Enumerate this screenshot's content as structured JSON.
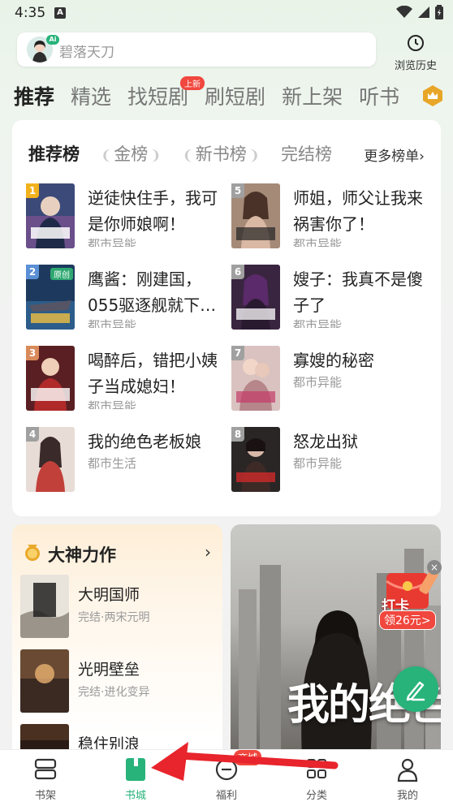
{
  "status_bar": {
    "time": "4:35",
    "notification_letter": "A"
  },
  "search": {
    "placeholder": "碧落天刀",
    "ai_badge": "Ai",
    "history_label": "浏览历史"
  },
  "tabs": [
    {
      "label": "推荐",
      "active": true
    },
    {
      "label": "精选"
    },
    {
      "label": "找短剧",
      "badge": "上新"
    },
    {
      "label": "刷短剧"
    },
    {
      "label": "新上架"
    },
    {
      "label": "听书"
    }
  ],
  "ranking": {
    "tabs": [
      {
        "label": "推荐榜",
        "active": true
      },
      {
        "label": "金榜"
      },
      {
        "label": "新书榜"
      },
      {
        "label": "完结榜"
      }
    ],
    "more_label": "更多榜单›",
    "books": [
      {
        "rank": "1",
        "title": "逆徒快住手，我可是你师娘啊！",
        "tag": "都市异能"
      },
      {
        "rank": "2",
        "title": "鹰酱：刚建国，055驱逐舰就下…",
        "tag": "都市异能",
        "badge": "原创"
      },
      {
        "rank": "3",
        "title": "喝醉后，错把小姨子当成媳妇！",
        "tag": "都市异能"
      },
      {
        "rank": "4",
        "title": "我的绝色老板娘",
        "tag": "都市生活"
      },
      {
        "rank": "5",
        "title": "师姐，师父让我来祸害你了！",
        "tag": "都市异能"
      },
      {
        "rank": "6",
        "title": "嫂子：我真不是傻子了",
        "tag": "都市异能"
      },
      {
        "rank": "7",
        "title": "寡嫂的秘密",
        "tag": "都市异能"
      },
      {
        "rank": "8",
        "title": "怒龙出狱",
        "tag": "都市异能"
      }
    ]
  },
  "god_works": {
    "title": "大神力作",
    "arrow": "›",
    "items": [
      {
        "name": "大明国师",
        "tag": "完结·两宋元明"
      },
      {
        "name": "光明壁垒",
        "tag": "完结·进化变异"
      },
      {
        "name": "稳住别浪",
        "tag": ""
      }
    ]
  },
  "banner": {
    "text": "我的绝色小姨"
  },
  "checkin": {
    "label": "打卡",
    "sub": "领26元>",
    "close": "×"
  },
  "bottom_nav": [
    {
      "label": "书架",
      "icon": "bookshelf-icon"
    },
    {
      "label": "书城",
      "icon": "bookstore-icon",
      "active": true
    },
    {
      "label": "福利",
      "icon": "welfare-icon",
      "badge": "商城"
    },
    {
      "label": "分类",
      "icon": "category-icon"
    },
    {
      "label": "我的",
      "icon": "profile-icon"
    }
  ],
  "colors": {
    "accent": "#27b37a",
    "badge_red": "#f0473e",
    "rank_gold": "#f2b21d",
    "rank_blue": "#5b8fd6"
  }
}
